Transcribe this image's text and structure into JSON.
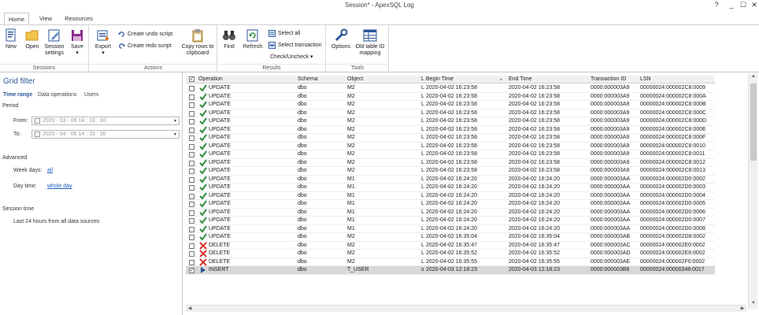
{
  "window": {
    "title": "Session* - ApexSQL Log",
    "help": "?",
    "minimize": "_",
    "maximize": "☐",
    "close": "✕"
  },
  "tabs": [
    {
      "label": "Home",
      "active": true
    },
    {
      "label": "View",
      "active": false
    },
    {
      "label": "Resources",
      "active": false
    }
  ],
  "ribbon": {
    "sessions": {
      "label": "Sessions",
      "new": "New",
      "open": "Open",
      "session_settings_1": "Session",
      "session_settings_2": "settings",
      "save": "Save",
      "save_arrow": "▾"
    },
    "actions": {
      "label": "Actions",
      "export": "Export",
      "export_arrow": "▾",
      "create_undo": "Create undo script",
      "create_redo": "Create redo script",
      "copy_rows_1": "Copy rows to",
      "copy_rows_2": "clipboard"
    },
    "results": {
      "label": "Results",
      "find": "Find",
      "refresh": "Refresh",
      "select_all": "Select all",
      "select_transaction": "Select transaction",
      "check_uncheck": "Check/Uncheck",
      "check_arrow": "▾"
    },
    "tools": {
      "label": "Tools",
      "options": "Options",
      "old_table_1": "Old table ID",
      "old_table_2": "mapping"
    }
  },
  "filter_panel": {
    "title": "Grid filter",
    "subtabs": [
      "Time range",
      "Data operations",
      "Users"
    ],
    "period_label": "Period",
    "from_label": "From:",
    "from_value": "2020 - 03 - 06   14 : 33 : 30",
    "to_label": "To:",
    "to_value": "2020 - 04 - 06   14 : 33 : 30",
    "advanced_label": "Advanced",
    "week_days_label": "Week days:",
    "week_days_value": "all",
    "day_time_label": "Day time:",
    "day_time_value": "whole day",
    "session_time_label": "Session time",
    "session_time_value": "Last 24 hours from all data sources"
  },
  "grid": {
    "header_checked": true,
    "columns": {
      "operation": "Operation",
      "schema": "Schema",
      "object": "Object",
      "user": "L",
      "begin_time": "Begin Time",
      "sort_indicator": "▲",
      "end_time": "End Time",
      "transaction_id": "Transaction ID",
      "lsn": "LSN"
    },
    "rows": [
      {
        "op": "UPDATE",
        "type": "update",
        "schema": "dbo",
        "object": "M2",
        "user": "L",
        "begin": "2020-04-02 16:23:58",
        "end": "2020-04-02 16:23:58",
        "tid": "0000:000003A9",
        "lsn": "00000024:000002C8:0009",
        "checked": false
      },
      {
        "op": "UPDATE",
        "type": "update",
        "schema": "dbo",
        "object": "M2",
        "user": "L",
        "begin": "2020-04-02 16:23:58",
        "end": "2020-04-02 16:23:58",
        "tid": "0000:000003A9",
        "lsn": "00000024:000002C8:000A",
        "checked": false
      },
      {
        "op": "UPDATE",
        "type": "update",
        "schema": "dbo",
        "object": "M2",
        "user": "L",
        "begin": "2020-04-02 16:23:58",
        "end": "2020-04-02 16:23:58",
        "tid": "0000:000003A9",
        "lsn": "00000024:000002C8:000B",
        "checked": false
      },
      {
        "op": "UPDATE",
        "type": "update",
        "schema": "dbo",
        "object": "M2",
        "user": "L",
        "begin": "2020-04-02 16:23:58",
        "end": "2020-04-02 16:23:58",
        "tid": "0000:000003A9",
        "lsn": "00000024:000002C8:000C",
        "checked": false
      },
      {
        "op": "UPDATE",
        "type": "update",
        "schema": "dbo",
        "object": "M2",
        "user": "L",
        "begin": "2020-04-02 16:23:58",
        "end": "2020-04-02 16:23:58",
        "tid": "0000:000003A9",
        "lsn": "00000024:000002C8:000D",
        "checked": false
      },
      {
        "op": "UPDATE",
        "type": "update",
        "schema": "dbo",
        "object": "M2",
        "user": "L",
        "begin": "2020-04-02 16:23:58",
        "end": "2020-04-02 16:23:58",
        "tid": "0000:000003A9",
        "lsn": "00000024:000002C8:000E",
        "checked": false
      },
      {
        "op": "UPDATE",
        "type": "update",
        "schema": "dbo",
        "object": "M2",
        "user": "L",
        "begin": "2020-04-02 16:23:58",
        "end": "2020-04-02 16:23:58",
        "tid": "0000:000003A9",
        "lsn": "00000024:000002C8:000F",
        "checked": false
      },
      {
        "op": "UPDATE",
        "type": "update",
        "schema": "dbo",
        "object": "M2",
        "user": "L",
        "begin": "2020-04-02 16:23:58",
        "end": "2020-04-02 16:23:58",
        "tid": "0000:000003A9",
        "lsn": "00000024:000002C8:0010",
        "checked": false
      },
      {
        "op": "UPDATE",
        "type": "update",
        "schema": "dbo",
        "object": "M2",
        "user": "L",
        "begin": "2020-04-02 16:23:58",
        "end": "2020-04-02 16:23:58",
        "tid": "0000:000003A9",
        "lsn": "00000024:000002C8:0011",
        "checked": false
      },
      {
        "op": "UPDATE",
        "type": "update",
        "schema": "dbo",
        "object": "M2",
        "user": "L",
        "begin": "2020-04-02 16:23:58",
        "end": "2020-04-02 16:23:58",
        "tid": "0000:000003A9",
        "lsn": "00000024:000002C8:0012",
        "checked": false
      },
      {
        "op": "UPDATE",
        "type": "update",
        "schema": "dbo",
        "object": "M2",
        "user": "L",
        "begin": "2020-04-02 16:23:58",
        "end": "2020-04-02 16:23:58",
        "tid": "0000:000003A9",
        "lsn": "00000024:000002C8:0013",
        "checked": false
      },
      {
        "op": "UPDATE",
        "type": "update",
        "schema": "dbo",
        "object": "M1",
        "user": "L",
        "begin": "2020-04-02 16:24:20",
        "end": "2020-04-02 16:24:20",
        "tid": "0000:000003AA",
        "lsn": "00000024:000002D0:0002",
        "checked": false
      },
      {
        "op": "UPDATE",
        "type": "update",
        "schema": "dbo",
        "object": "M1",
        "user": "L",
        "begin": "2020-04-02 16:24:20",
        "end": "2020-04-02 16:24:20",
        "tid": "0000:000003AA",
        "lsn": "00000024:000002D0:0003",
        "checked": false
      },
      {
        "op": "UPDATE",
        "type": "update",
        "schema": "dbo",
        "object": "M1",
        "user": "L",
        "begin": "2020-04-02 16:24:20",
        "end": "2020-04-02 16:24:20",
        "tid": "0000:000003AA",
        "lsn": "00000024:000002D0:0004",
        "checked": false
      },
      {
        "op": "UPDATE",
        "type": "update",
        "schema": "dbo",
        "object": "M1",
        "user": "L",
        "begin": "2020-04-02 16:24:20",
        "end": "2020-04-02 16:24:20",
        "tid": "0000:000003AA",
        "lsn": "00000024:000002D0:0005",
        "checked": false
      },
      {
        "op": "UPDATE",
        "type": "update",
        "schema": "dbo",
        "object": "M1",
        "user": "L",
        "begin": "2020-04-02 16:24:20",
        "end": "2020-04-02 16:24:20",
        "tid": "0000:000003AA",
        "lsn": "00000024:000002D0:0006",
        "checked": false
      },
      {
        "op": "UPDATE",
        "type": "update",
        "schema": "dbo",
        "object": "M1",
        "user": "L",
        "begin": "2020-04-02 16:24:20",
        "end": "2020-04-02 16:24:20",
        "tid": "0000:000003AA",
        "lsn": "00000024:000002D0:0007",
        "checked": false
      },
      {
        "op": "UPDATE",
        "type": "update",
        "schema": "dbo",
        "object": "M1",
        "user": "L",
        "begin": "2020-04-02 16:24:20",
        "end": "2020-04-02 16:24:20",
        "tid": "0000:000003AA",
        "lsn": "00000024:000002D0:0008",
        "checked": false
      },
      {
        "op": "UPDATE",
        "type": "update",
        "schema": "dbo",
        "object": "M2",
        "user": "L",
        "begin": "2020-04-02 16:35:04",
        "end": "2020-04-02 16:35:04",
        "tid": "0000:000003AB",
        "lsn": "00000024:000002D8:0002",
        "checked": false
      },
      {
        "op": "DELETE",
        "type": "delete",
        "schema": "dbo",
        "object": "M2",
        "user": "L",
        "begin": "2020-04-02 16:35:47",
        "end": "2020-04-02 16:35:47",
        "tid": "0000:000003AC",
        "lsn": "00000024:000002E0:0002",
        "checked": false
      },
      {
        "op": "DELETE",
        "type": "delete",
        "schema": "dbo",
        "object": "M2",
        "user": "L",
        "begin": "2020-04-02 16:35:52",
        "end": "2020-04-02 16:35:52",
        "tid": "0000:000003AD",
        "lsn": "00000024:000002E8:0002",
        "checked": false
      },
      {
        "op": "DELETE",
        "type": "delete",
        "schema": "dbo",
        "object": "M2",
        "user": "L",
        "begin": "2020-04-02 16:35:55",
        "end": "2020-04-02 16:35:55",
        "tid": "0000:000003AE",
        "lsn": "00000024:000002F0:0002",
        "checked": false
      },
      {
        "op": "INSERT",
        "type": "insert",
        "schema": "dbo",
        "object": "T_USER",
        "user": "s",
        "begin": "2020-04-03 12:18:23",
        "end": "2020-04-03 12:18:23",
        "tid": "0000:000003B6",
        "lsn": "00000024:00000348:0017",
        "checked": true,
        "selected": true
      }
    ]
  },
  "colors": {
    "accent": "#2b5797",
    "update": "#2e8b3a",
    "delete": "#d9342b",
    "insert": "#2b5797",
    "link": "#1f5fbf"
  }
}
